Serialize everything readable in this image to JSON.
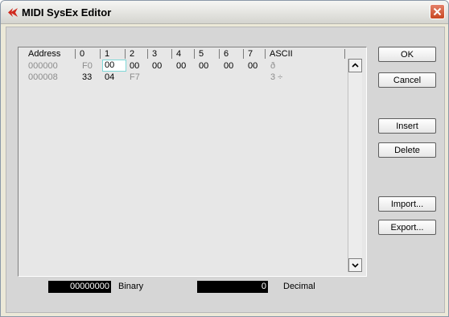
{
  "window": {
    "title": "MIDI SysEx Editor",
    "close_icon": "close-icon",
    "logo_icon": "cubase-logo-icon"
  },
  "grid": {
    "headers": [
      "Address",
      "0",
      "1",
      "2",
      "3",
      "4",
      "5",
      "6",
      "7",
      "ASCII"
    ],
    "rows": [
      {
        "address": "000000",
        "bytes": [
          "F0",
          "00",
          "00",
          "00",
          "00",
          "00",
          "00",
          "00"
        ],
        "ascii": "ð"
      },
      {
        "address": "000008",
        "bytes": [
          "33",
          "04",
          "F7"
        ],
        "ascii": "3 ÷"
      }
    ],
    "selected_cell": {
      "row": 0,
      "byte": 1
    }
  },
  "buttons": {
    "ok": "OK",
    "cancel": "Cancel",
    "insert": "Insert",
    "delete": "Delete",
    "import": "Import...",
    "export": "Export..."
  },
  "fields": {
    "binary_value": "00000000",
    "binary_label": "Binary",
    "decimal_value": "0",
    "decimal_label": "Decimal"
  },
  "colors": {
    "field_bg": "#000000",
    "selected_outline": "#7fd8d8",
    "close_red": "#c84722"
  }
}
